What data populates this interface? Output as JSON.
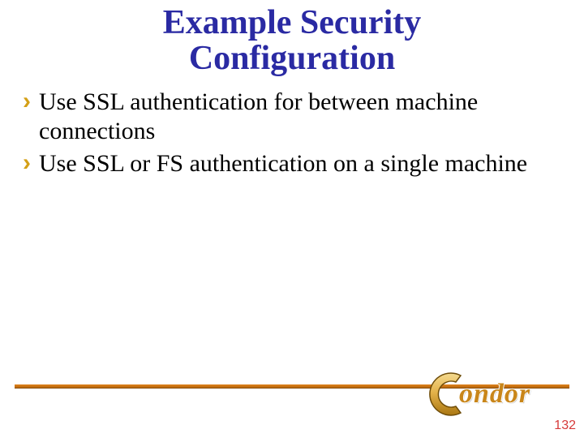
{
  "title_line1": "Example Security",
  "title_line2": "Configuration",
  "bullets": [
    "Use SSL authentication for between machine connections",
    "Use SSL or FS authentication on a single machine"
  ],
  "logo_word": "ondor",
  "page_number": "132"
}
